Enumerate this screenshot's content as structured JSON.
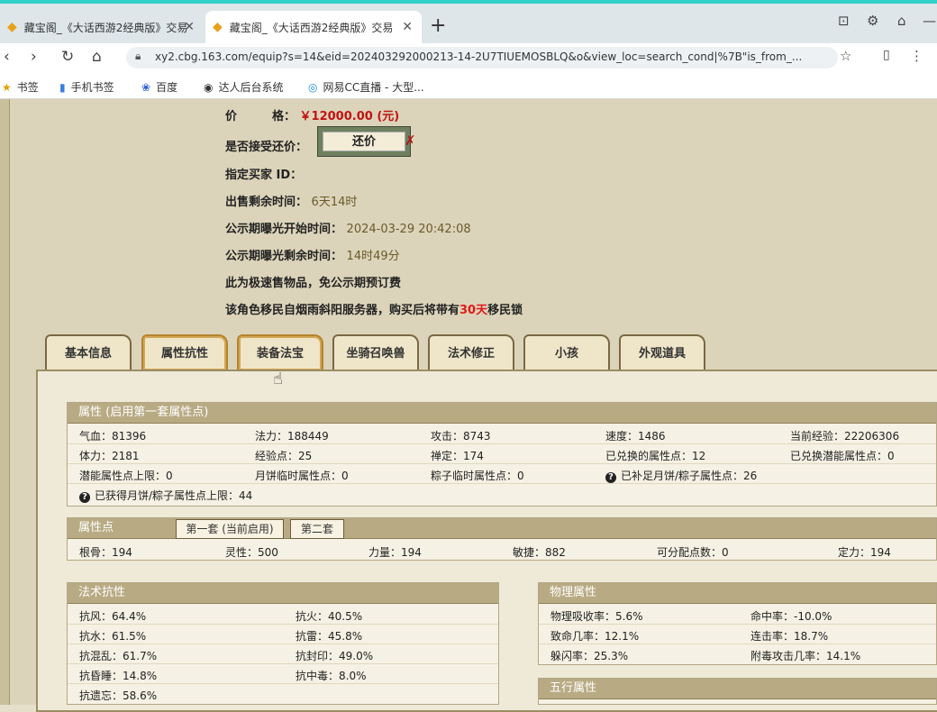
{
  "browser": {
    "tabs": [
      {
        "title": "藏宝阁_《大话西游2经典版》交易",
        "active": false
      },
      {
        "title": "藏宝阁_《大话西游2经典版》交易",
        "active": true
      }
    ],
    "url": "xy2.cbg.163.com/equip?s=14&eid=202403292000213-14-2U7TIUEMOSBLQ&o&view_loc=search_cond|%7B\"is_from_...",
    "bookmarks": [
      "书签",
      "手机书签",
      "百度",
      "达人后台系统",
      "网易CC直播 - 大型..."
    ]
  },
  "listing": {
    "price_label": "价　　　格：",
    "price_value": "￥12000.00 (元)",
    "accept_offer_label": "是否接受还价：",
    "offer_button": "还价",
    "buyer_id_label": "指定买家 ID：",
    "remaining_label": "出售剩余时间：",
    "remaining_value": "6天14时",
    "exposure_start_label": "公示期曝光开始时间：",
    "exposure_start_value": "2024-03-29 20:42:08",
    "exposure_remaining_label": "公示期曝光剩余时间：",
    "exposure_remaining_value": "14时49分",
    "fast_sale_note": "此为极速售物品，免公示期预订费",
    "migration_note_a": "该角色移民自烟雨斜阳服务器，购买后将带有",
    "migration_days": "30天",
    "migration_note_b": "移民锁"
  },
  "page_tabs": [
    "基本信息",
    "属性抗性",
    "装备法宝",
    "坐骑召唤兽",
    "法术修正",
    "小孩",
    "外观道具"
  ],
  "attributes": {
    "title": "属性 (启用第一套属性点)",
    "row1": [
      "气血：81396",
      "法力：188449",
      "攻击：8743",
      "速度：1486",
      "当前经验：22206306"
    ],
    "row2": [
      "体力：2181",
      "经验点：25",
      "禅定：174",
      "已兑换的属性点：12",
      "已兑换潜能属性点：0"
    ],
    "row3": [
      "潜能属性点上限：0",
      "月饼临时属性点：0",
      "粽子临时属性点：0",
      "已补足月饼/粽子属性点：26"
    ],
    "row4": [
      "已获得月饼/粽子属性点上限：44"
    ]
  },
  "points": {
    "title": "属性点",
    "tab1": "第一套 (当前启用)",
    "tab2": "第二套",
    "values": [
      "根骨：194",
      "灵性：500",
      "力量：194",
      "敏捷：882",
      "可分配点数：0",
      "定力：194"
    ]
  },
  "resist": {
    "title": "法术抗性",
    "left": [
      "抗风：64.4%",
      "抗水：61.5%",
      "抗混乱：61.7%",
      "抗昏睡：14.8%",
      "抗遗忘：58.6%"
    ],
    "right": [
      "抗火：40.5%",
      "抗雷：45.8%",
      "抗封印：49.0%",
      "抗中毒：8.0%"
    ]
  },
  "physical": {
    "title": "物理属性",
    "left": [
      "物理吸收率：5.6%",
      "致命几率：12.1%",
      "躲闪率：25.3%"
    ],
    "right": [
      "命中率：-10.0%",
      "连击率：18.7%",
      "附毒攻击几率：14.1%"
    ]
  },
  "elements": {
    "title": "五行属性"
  }
}
